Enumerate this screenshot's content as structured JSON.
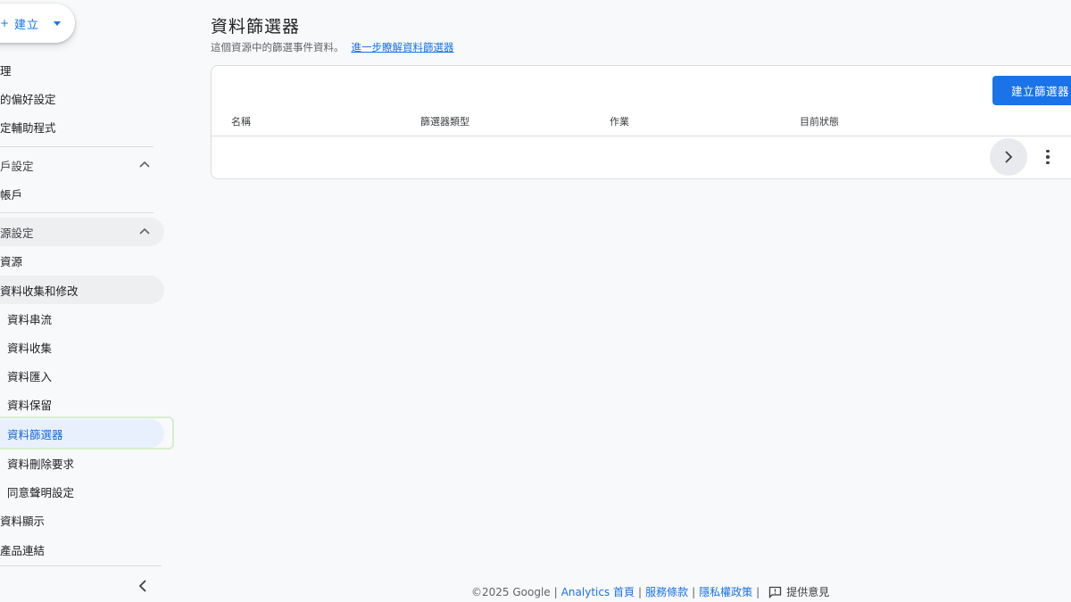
{
  "sidebar": {
    "create_button": {
      "plus": "+",
      "label": "建立"
    },
    "items": [
      {
        "label": "理"
      },
      {
        "label": "的偏好設定"
      },
      {
        "label": "定輔助程式"
      },
      {
        "label": "戶設定"
      },
      {
        "label": "帳戶"
      },
      {
        "label": "源設定"
      },
      {
        "label": "資源"
      },
      {
        "label": "資料收集和修改"
      },
      {
        "label": "資料串流"
      },
      {
        "label": "資料收集"
      },
      {
        "label": "資料匯入"
      },
      {
        "label": "資料保留"
      },
      {
        "label": "資料篩選器"
      },
      {
        "label": "資料刪除要求"
      },
      {
        "label": "同意聲明設定"
      },
      {
        "label": "資料顯示"
      },
      {
        "label": "產品連結"
      }
    ]
  },
  "main": {
    "title": "資料篩選器",
    "subtitle": "這個資源中的篩選事件資料。",
    "learn_more": "進一步瞭解資料篩選器",
    "create_filter_button": "建立篩選器",
    "columns": [
      "名稱",
      "篩選器類型",
      "作業",
      "目前狀態"
    ]
  },
  "footer": {
    "copyright": "©2025 Google",
    "analytics_home": "Analytics 首頁",
    "terms": "服務條款",
    "privacy": "隱私權政策",
    "feedback": "提供意見"
  },
  "colors": {
    "accent": "#1a73e8",
    "selected_bg": "#e8f0fe",
    "selected_outline": "#d7edd0",
    "background": "#f8f9fa"
  }
}
